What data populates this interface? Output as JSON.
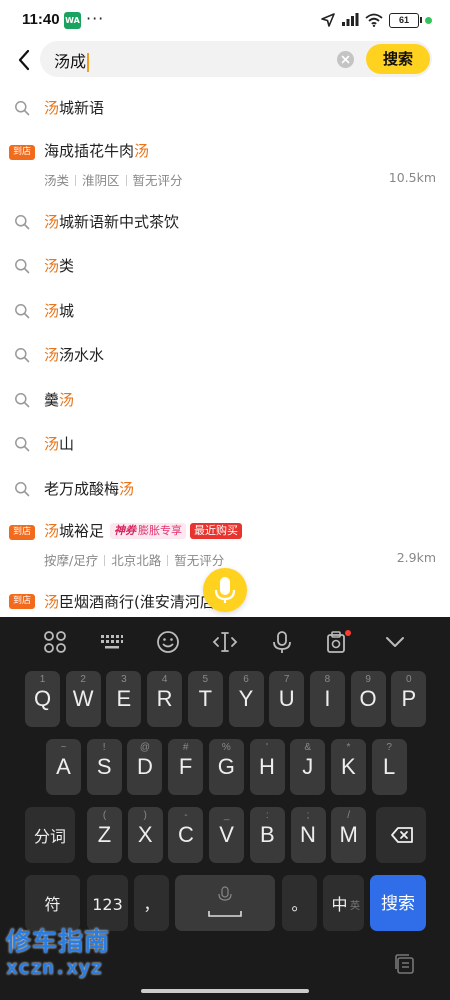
{
  "status_bar": {
    "time": "11:40",
    "app_badge": "WA",
    "more": "···",
    "battery": "61"
  },
  "search": {
    "query": "汤成",
    "button_label": "搜索"
  },
  "suggestions": [
    {
      "type": "query",
      "parts": [
        {
          "t": "汤",
          "h": true
        },
        {
          "t": "城新语",
          "h": false
        }
      ]
    },
    {
      "type": "shop",
      "badge": "到店",
      "parts": [
        {
          "t": "海成插花牛肉",
          "h": false
        },
        {
          "t": "汤",
          "h": true
        }
      ],
      "meta": [
        "汤类",
        "淮阴区",
        "暂无评分"
      ],
      "distance": "10.5km"
    },
    {
      "type": "query",
      "parts": [
        {
          "t": "汤",
          "h": true
        },
        {
          "t": "城新语新中式茶饮",
          "h": false
        }
      ]
    },
    {
      "type": "query",
      "parts": [
        {
          "t": "汤",
          "h": true
        },
        {
          "t": "类",
          "h": false
        }
      ]
    },
    {
      "type": "query",
      "parts": [
        {
          "t": "汤",
          "h": true
        },
        {
          "t": "城",
          "h": false
        }
      ]
    },
    {
      "type": "query",
      "parts": [
        {
          "t": "汤",
          "h": true
        },
        {
          "t": "汤水水",
          "h": false
        }
      ]
    },
    {
      "type": "query",
      "parts": [
        {
          "t": "羹",
          "h": false
        },
        {
          "t": "汤",
          "h": true
        }
      ]
    },
    {
      "type": "query",
      "parts": [
        {
          "t": "汤",
          "h": true
        },
        {
          "t": "山",
          "h": false
        }
      ]
    },
    {
      "type": "query",
      "parts": [
        {
          "t": "老万成酸梅",
          "h": false
        },
        {
          "t": "汤",
          "h": true
        }
      ]
    },
    {
      "type": "shop",
      "badge": "到店",
      "parts": [
        {
          "t": "汤",
          "h": true
        },
        {
          "t": "城裕足",
          "h": false
        }
      ],
      "tags": {
        "promo_prefix": "神券",
        "promo": "膨胀专享",
        "recent": "最近购买"
      },
      "meta": [
        "按摩/足疗",
        "北京北路",
        "暂无评分"
      ],
      "distance": "2.9km"
    },
    {
      "type": "shop",
      "badge": "到店",
      "parts": [
        {
          "t": "汤",
          "h": true
        },
        {
          "t": "臣烟酒商行(淮安清河",
          "h": false
        },
        {
          "t": "店)",
          "h": false
        }
      ]
    }
  ],
  "keyboard": {
    "row1": [
      [
        "Q",
        "1"
      ],
      [
        "W",
        "2"
      ],
      [
        "E",
        "3"
      ],
      [
        "R",
        "4"
      ],
      [
        "T",
        "5"
      ],
      [
        "Y",
        "6"
      ],
      [
        "U",
        "7"
      ],
      [
        "I",
        "8"
      ],
      [
        "O",
        "9"
      ],
      [
        "P",
        "0"
      ]
    ],
    "row2": [
      [
        "A",
        "~"
      ],
      [
        "S",
        "!"
      ],
      [
        "D",
        "@"
      ],
      [
        "F",
        "#"
      ],
      [
        "G",
        "%"
      ],
      [
        "H",
        "'"
      ],
      [
        "J",
        "&"
      ],
      [
        "K",
        "*"
      ],
      [
        "L",
        "?"
      ]
    ],
    "row3": [
      [
        "Z",
        "("
      ],
      [
        "X",
        ")"
      ],
      [
        "C",
        "-"
      ],
      [
        "V",
        "_"
      ],
      [
        "B",
        ":"
      ],
      [
        "N",
        ";"
      ],
      [
        "M",
        "/"
      ]
    ],
    "fenci": "分词",
    "symbols": "符",
    "num": "123",
    "comma": "，",
    "period": "。",
    "lang": "中",
    "lang_sub": "英",
    "enter": "搜索"
  },
  "watermark": {
    "line1": "修车指南",
    "line2": "xczn.xyz"
  },
  "colors": {
    "accent": "#ffd21f",
    "highlight": "#e8751a",
    "store_badge": "#f26a1b",
    "keyboard_bg": "#1b1b1b",
    "key_bg": "#3a3a3a",
    "enter_key": "#2f6ee8"
  }
}
